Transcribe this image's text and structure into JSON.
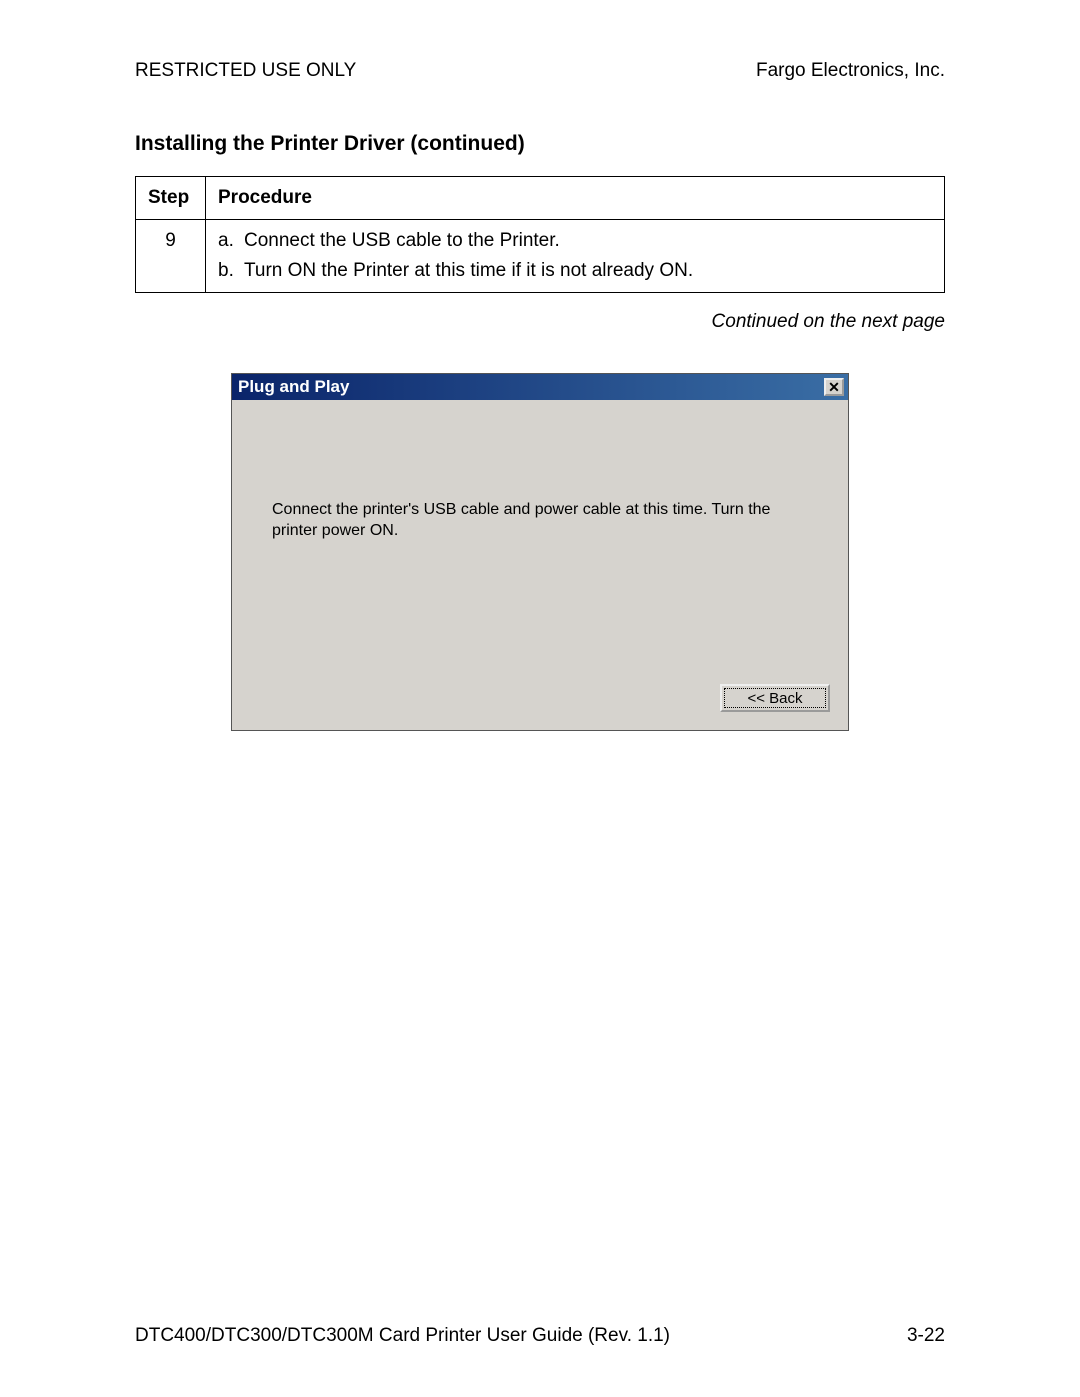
{
  "header": {
    "left": "RESTRICTED USE ONLY",
    "right": "Fargo Electronics, Inc."
  },
  "section_title": "Installing the Printer Driver (continued)",
  "table": {
    "head_step": "Step",
    "head_proc": "Procedure",
    "step_number": "9",
    "items": [
      {
        "letter": "a.",
        "text": "Connect the USB cable to the Printer."
      },
      {
        "letter": "b.",
        "text": "Turn ON the Printer at this time if it is not already ON."
      }
    ]
  },
  "continued_text": "Continued on the next page",
  "dialog": {
    "title": "Plug and Play",
    "close_glyph": "✕",
    "message": "Connect the printer's USB cable and power cable at this time.  Turn the printer power ON.",
    "back_label": "<< Back"
  },
  "footer": {
    "left": "DTC400/DTC300/DTC300M Card Printer User Guide (Rev. 1.1)",
    "right": "3-22"
  }
}
